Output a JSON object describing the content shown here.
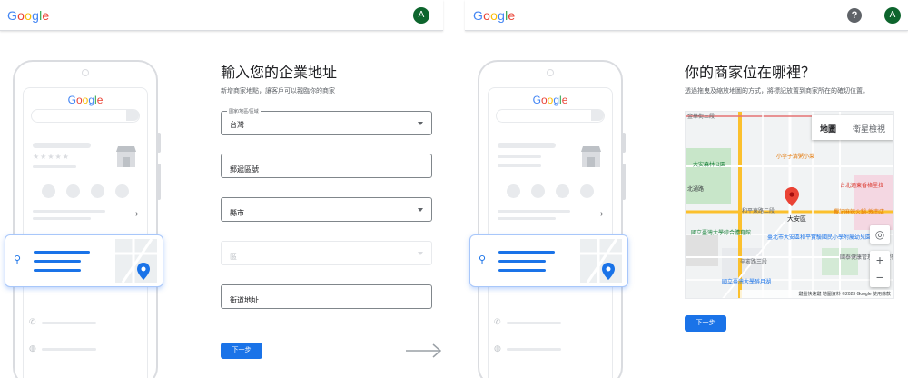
{
  "left_panel": {
    "logo": [
      "G",
      "o",
      "o",
      "g",
      "l",
      "e"
    ],
    "avatar_letter": "A",
    "phone": {
      "logo": [
        "G",
        "o",
        "o",
        "g",
        "l",
        "e"
      ],
      "stars": "★★★★★"
    },
    "form": {
      "title": "輸入您的企業地址",
      "subtitle": "新增商家地點，讓客戶可以親臨你的商家",
      "country_label": "國家/地區/區域",
      "country_value": "台灣",
      "postal_placeholder": "郵遞區號",
      "city_placeholder": "縣市",
      "district_placeholder": "區",
      "street_placeholder": "街道地址",
      "next_button": "下一步"
    }
  },
  "right_panel": {
    "logo": [
      "G",
      "o",
      "o",
      "g",
      "l",
      "e"
    ],
    "help_icon": "?",
    "avatar_letter": "A",
    "phone": {
      "logo": [
        "G",
        "o",
        "o",
        "g",
        "l",
        "e"
      ]
    },
    "title": "你的商家位在哪裡？",
    "subtitle": "透過拖曳及縮放地圖的方式，將標記放置到商家所在的確切位置。",
    "map": {
      "tab_map": "地圖",
      "tab_satellite": "衛星檢視",
      "labels": {
        "l1": "金華街三段",
        "l2": "大安森林公園",
        "l3": "小李子清粥小菜",
        "l4": "台北適東香格里拉",
        "l5": "北通路",
        "l6": "和平東路二段",
        "l7": "大安區",
        "l8": "饗記麻辣火鍋-敦南店",
        "l9": "國立臺灣大學綜合體育館",
        "l10": "臺北市大安區和平實驗國民小學附屬幼兒園",
        "l11": "國泰健康管理(敦南健檢中心)",
        "l12": "辛亥路三段",
        "l13": "國立臺灣大學醉月湖"
      },
      "attribution": "鍵盤快速鍵  地圖資料 ©2023 Google  使用條款"
    },
    "next_button": "下一步"
  }
}
